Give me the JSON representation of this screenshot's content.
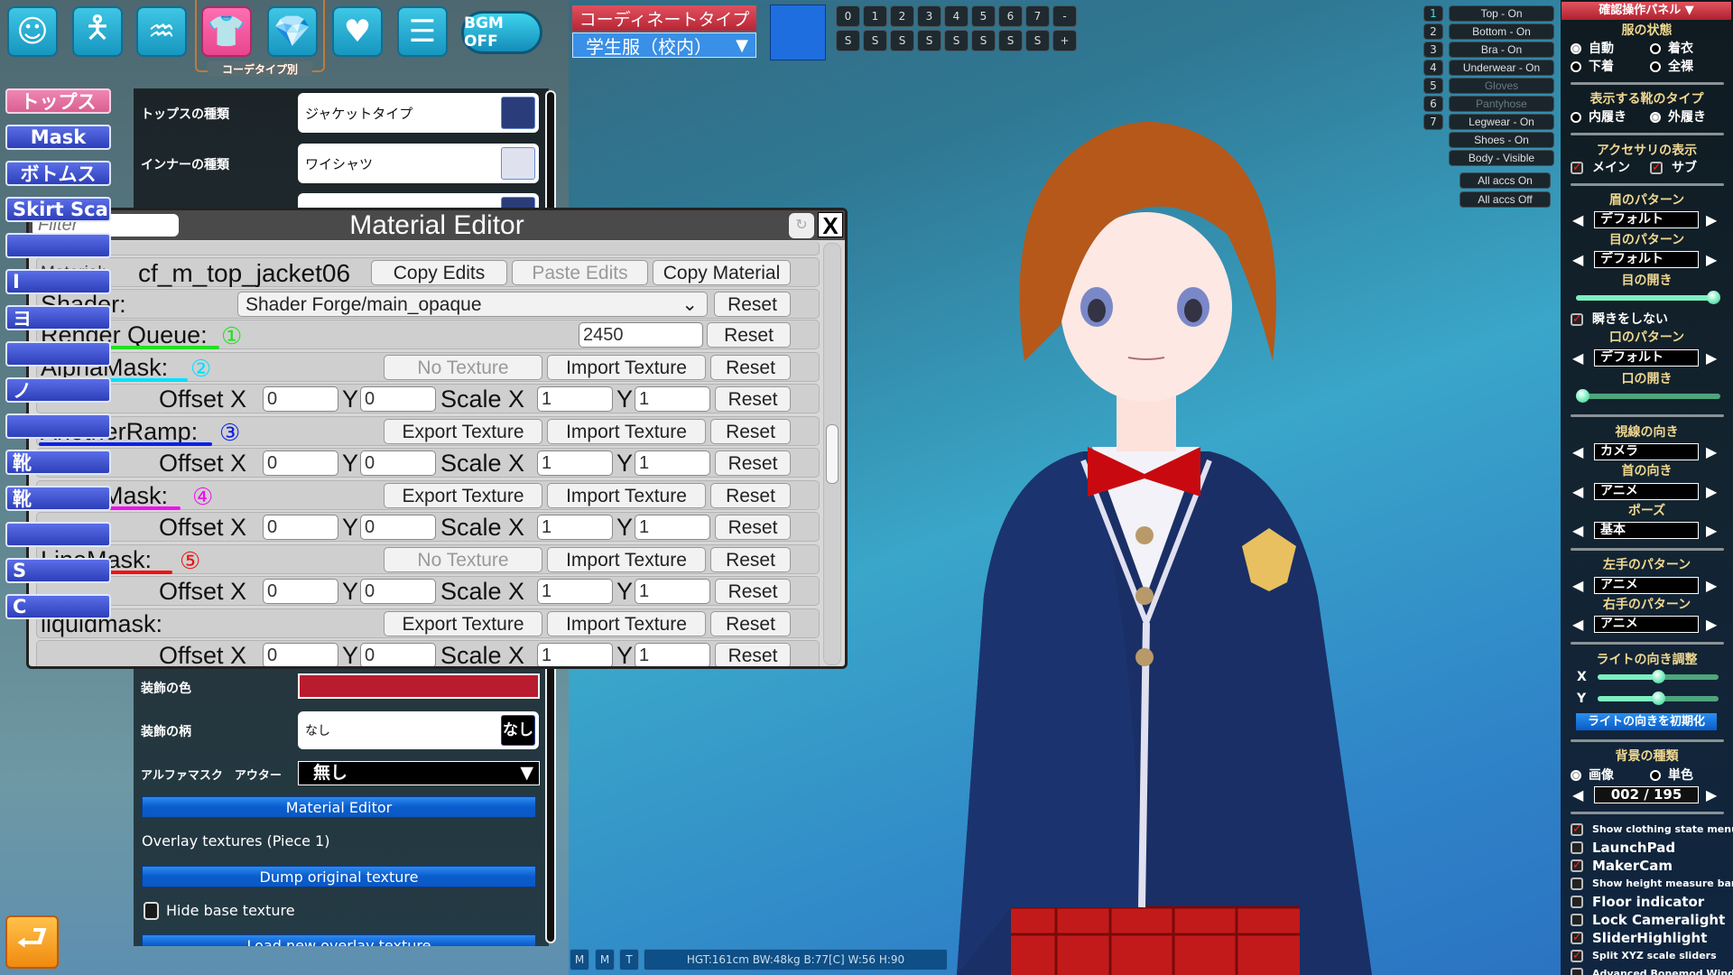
{
  "toolbar": {
    "icons": [
      "face-icon",
      "body-icon",
      "hair-icon",
      "clothes-icon",
      "accessory-icon",
      "heart-icon",
      "document-icon"
    ],
    "active_index": 3,
    "active_caption": "コーデタイプ別",
    "bgm_label": "BGM OFF"
  },
  "coordinate": {
    "label": "コーディネートタイプ",
    "value": "学生服（校内）",
    "color": "#1e6ee0"
  },
  "slots": {
    "top": [
      "0",
      "1",
      "2",
      "3",
      "4",
      "5",
      "6",
      "7",
      "-"
    ],
    "bottom": [
      "S",
      "S",
      "S",
      "S",
      "S",
      "S",
      "S",
      "S",
      "+"
    ]
  },
  "sidebar": {
    "active_index": 0,
    "items": [
      "トップス",
      "Mask",
      "ボトムス",
      "Skirt Scale",
      "",
      "I",
      "ヨ",
      "",
      "ノ",
      "",
      "靴",
      "靴",
      "",
      "S",
      "C"
    ]
  },
  "panel": {
    "rows": [
      {
        "label": "トップスの種類",
        "value": "ジャケットタイプ"
      },
      {
        "label": "インナーの種類",
        "value": "ワイシャツ"
      }
    ],
    "decoration_color_label": "装飾の色",
    "decoration_color": "#b81c2e",
    "decoration_pattern_label": "装飾の柄",
    "decoration_pattern_value": "なし",
    "decoration_pattern_thumb": "なし",
    "alpha_mask_label": "アルファマスク　アウター",
    "alpha_mask_value": "無し",
    "material_editor_button": "Material Editor",
    "overlay_label": "Overlay textures (Piece 1)",
    "dump_button": "Dump original texture",
    "hide_base_label": "Hide base texture",
    "hide_base_checked": false,
    "load_button": "Load new overlay texture"
  },
  "material_editor": {
    "title": "Material Editor",
    "filter_placeholder": "Filter",
    "material_label": "Material:",
    "material_name": "cf_m_top_jacket06",
    "copy_edits": "Copy Edits",
    "paste_edits": "Paste Edits",
    "copy_material": "Copy Material",
    "shader_label": "Shader:",
    "shader_value": "Shader Forge/main_opaque",
    "render_queue_label": "Render Queue:",
    "render_queue_value": "2450",
    "render_queue_marker": "①",
    "render_queue_color": "#22e022",
    "reset": "Reset",
    "offset_x": "Offset X",
    "y": "Y",
    "scale_x": "Scale X",
    "textures": [
      {
        "name": "AlphaMask:",
        "marker": "②",
        "color": "#00e0ff",
        "texture_button": "No Texture",
        "has_texture": false,
        "import": "Import Texture",
        "offset_x": "0",
        "offset_y": "0",
        "scale_x": "1",
        "scale_y": "1"
      },
      {
        "name": "AnotherRamp:",
        "marker": "③",
        "color": "#0a20e8",
        "texture_button": "Export Texture",
        "has_texture": true,
        "import": "Import Texture",
        "offset_x": "0",
        "offset_y": "0",
        "scale_x": "1",
        "scale_y": "1"
      },
      {
        "name": "DetailMask:",
        "marker": "④",
        "color": "#f010f0",
        "texture_button": "Export Texture",
        "has_texture": true,
        "import": "Import Texture",
        "offset_x": "0",
        "offset_y": "0",
        "scale_x": "1",
        "scale_y": "1"
      },
      {
        "name": "LineMask:",
        "marker": "⑤",
        "color": "#f01010",
        "texture_button": "No Texture",
        "has_texture": false,
        "import": "Import Texture",
        "offset_x": "0",
        "offset_y": "0",
        "scale_x": "1",
        "scale_y": "1"
      },
      {
        "name": "liquidmask:",
        "marker": "",
        "color": "",
        "texture_button": "Export Texture",
        "has_texture": true,
        "import": "Import Texture",
        "offset_x": "0",
        "offset_y": "0",
        "scale_x": "1",
        "scale_y": "1"
      }
    ]
  },
  "status_bar": {
    "buttons": [
      "M",
      "M",
      "T"
    ],
    "info": "HGT:161cm  BW:48kg  B:77[C]  W:56  H:90"
  },
  "clothing_toggles": {
    "numbers": [
      "1",
      "2",
      "3",
      "4",
      "5",
      "6",
      "7"
    ],
    "active_number": "1",
    "items": [
      {
        "label": "Top - On",
        "enabled": true
      },
      {
        "label": "Bottom - On",
        "enabled": true
      },
      {
        "label": "Bra - On",
        "enabled": true
      },
      {
        "label": "Underwear - On",
        "enabled": true
      },
      {
        "label": "Gloves",
        "enabled": false
      },
      {
        "label": "Pantyhose",
        "enabled": false
      },
      {
        "label": "Legwear - On",
        "enabled": true
      },
      {
        "label": "Shoes - On",
        "enabled": true
      },
      {
        "label": "Body - Visible",
        "enabled": true
      }
    ],
    "all_on": "All accs On",
    "all_off": "All accs Off"
  },
  "confirm_panel": {
    "title": "確認操作パネル",
    "clothing_state": {
      "title": "服の状態",
      "options": [
        "自動",
        "着衣",
        "下着",
        "全裸"
      ],
      "selected": "自動"
    },
    "shoe_type": {
      "title": "表示する靴のタイプ",
      "options": [
        "内履き",
        "外履き"
      ],
      "selected": "外履き"
    },
    "accessories": {
      "title": "アクセサリの表示",
      "main": "メイン",
      "main_checked": true,
      "sub": "サブ",
      "sub_checked": true
    },
    "eyebrow": {
      "title": "眉のパターン",
      "value": "デフォルト"
    },
    "eye": {
      "title": "目のパターン",
      "value": "デフォルト"
    },
    "eye_open": {
      "title": "目の開き",
      "value": 1.0
    },
    "no_blink": {
      "label": "瞬きをしない",
      "checked": true
    },
    "mouth": {
      "title": "口のパターン",
      "value": "デフォルト"
    },
    "mouth_open": {
      "title": "口の開き",
      "value": 0.0
    },
    "gaze": {
      "title": "視線の向き",
      "value": "カメラ"
    },
    "neck": {
      "title": "首の向き",
      "value": "アニメ"
    },
    "pose": {
      "title": "ポーズ",
      "value": "基本"
    },
    "left_hand": {
      "title": "左手のパターン",
      "value": "アニメ"
    },
    "right_hand": {
      "title": "右手のパターン",
      "value": "アニメ"
    },
    "light": {
      "title": "ライトの向き調整",
      "x_label": "X",
      "x_value": 0.5,
      "y_label": "Y",
      "y_value": 0.5,
      "reset": "ライトの向きを初期化"
    },
    "background": {
      "title": "背景の種類",
      "options": [
        "画像",
        "単色"
      ],
      "selected": "画像",
      "value": "002 / 195"
    },
    "options": [
      {
        "label": "Show clothing state menu",
        "checked": true,
        "small": true
      },
      {
        "label": "LaunchPad",
        "checked": false
      },
      {
        "label": "MakerCam",
        "checked": true
      },
      {
        "label": "Show height measure bar",
        "checked": false,
        "small": true
      },
      {
        "label": "Floor indicator",
        "checked": false
      },
      {
        "label": "Lock Cameralight",
        "checked": false
      },
      {
        "label": "SliderHighlight",
        "checked": true
      },
      {
        "label": "Split XYZ scale sliders",
        "checked": true,
        "small": true
      },
      {
        "label": "Advanced Bonemod Window",
        "checked": false,
        "small": true
      }
    ]
  }
}
